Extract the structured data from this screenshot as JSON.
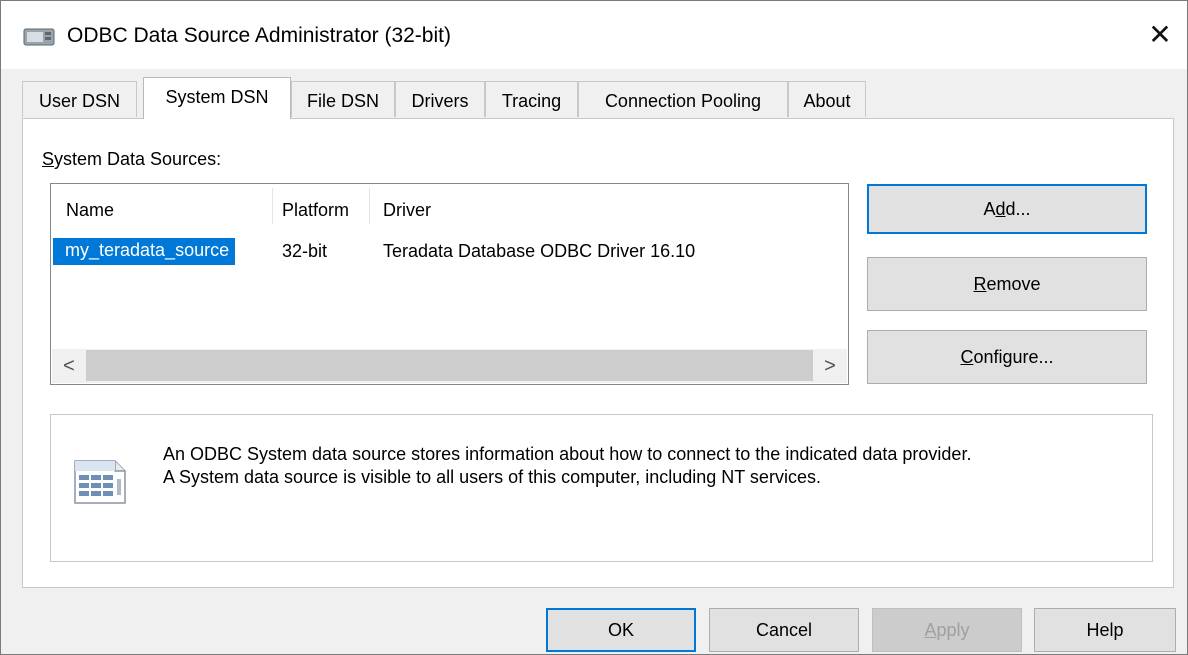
{
  "window": {
    "title": "ODBC Data Source Administrator (32-bit)",
    "close_glyph": "✕"
  },
  "tabs": [
    {
      "label": "User DSN"
    },
    {
      "label": "System DSN",
      "active": true
    },
    {
      "label": "File DSN"
    },
    {
      "label": "Drivers"
    },
    {
      "label": "Tracing"
    },
    {
      "label": "Connection Pooling"
    },
    {
      "label": "About"
    }
  ],
  "group": {
    "label_underlined": "S",
    "label_rest": "ystem Data Sources:"
  },
  "table": {
    "columns": [
      "Name",
      "Platform",
      "Driver"
    ],
    "rows": [
      {
        "name": "my_teradata_source",
        "platform": "32-bit",
        "driver": "Teradata Database ODBC Driver 16.10",
        "selected": true
      }
    ],
    "scroll_left": "<",
    "scroll_right": ">"
  },
  "side_buttons": {
    "add": {
      "pre": "A",
      "u": "d",
      "post": "d..."
    },
    "remove": {
      "pre": "",
      "u": "R",
      "post": "emove"
    },
    "configure": {
      "pre": "",
      "u": "C",
      "post": "onfigure..."
    }
  },
  "info": {
    "line1": "An ODBC System data source stores information about how to connect to the indicated data provider.",
    "line2": "A System data source is visible to all users of this computer, including NT services."
  },
  "footer": {
    "ok": "OK",
    "cancel": "Cancel",
    "apply": {
      "u": "A",
      "rest": "pply"
    },
    "help": "Help"
  },
  "colors": {
    "accent": "#0078d7",
    "selection_bg": "#0078d7"
  },
  "icons": {
    "app": "odbc-admin-icon",
    "info": "data-source-document-icon"
  }
}
